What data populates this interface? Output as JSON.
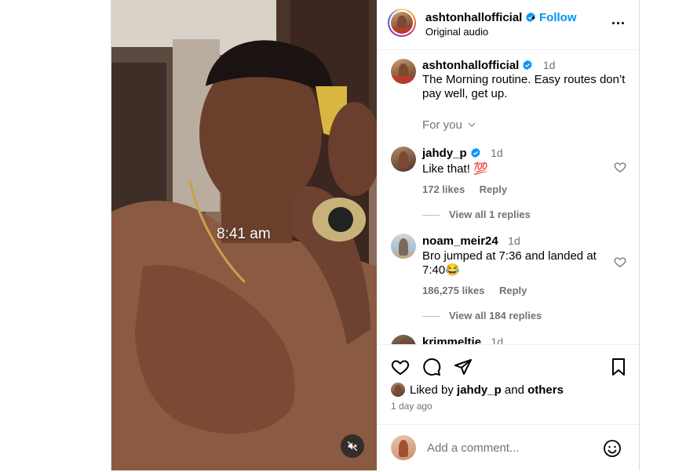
{
  "media": {
    "overlay_time": "8:41 am",
    "mute_icon": "speaker-muted-icon"
  },
  "header": {
    "username": "ashtonhallofficial",
    "separator": "•",
    "follow_label": "Follow",
    "audio_label": "Original audio",
    "more_icon": "more-options-icon"
  },
  "caption": {
    "username": "ashtonhallofficial",
    "age": "1d",
    "text": "The Morning routine. Easy routes don’t pay well, get up.",
    "for_you_label": "For you"
  },
  "comments": [
    {
      "username": "jahdy_p",
      "verified": true,
      "age": "1d",
      "text": "Like that! 💯",
      "likes": "172 likes",
      "reply_label": "Reply",
      "view_replies": "View all 1 replies"
    },
    {
      "username": "noam_meir24",
      "verified": false,
      "age": "1d",
      "text": "Bro jumped at 7:36 and landed at 7:40😂",
      "likes": "186,275 likes",
      "reply_label": "Reply",
      "view_replies": "View all 184 replies"
    },
    {
      "username": "krimmeltje",
      "verified": false,
      "age": "1d"
    }
  ],
  "actions": {
    "liked_prefix": "Liked by",
    "liked_user": "jahdy_p",
    "liked_and": "and",
    "liked_others": "others",
    "time_ago": "1 day ago",
    "comment_placeholder": "Add a comment...",
    "icons": [
      "heart-icon",
      "comment-icon",
      "share-icon",
      "bookmark-icon",
      "emoji-icon"
    ]
  },
  "colors": {
    "link_blue": "#0095f6",
    "verified_blue": "#0095f6",
    "muted_text": "#737373",
    "divider": "#efefef"
  }
}
